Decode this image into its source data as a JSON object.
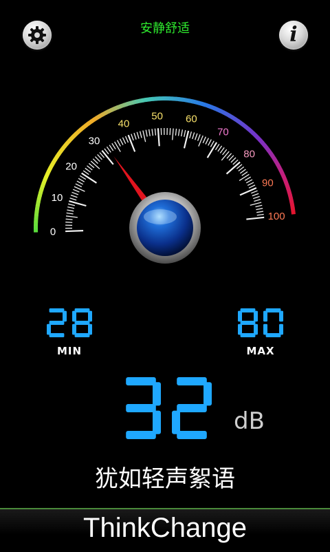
{
  "header": {
    "status_text": "安静舒适",
    "settings_icon": "gear-icon",
    "info_icon": "info-icon",
    "info_glyph": "i",
    "status_color": "#2eea2e"
  },
  "gauge": {
    "min": 0,
    "max": 100,
    "value": 32,
    "tick_labels": [
      "0",
      "10",
      "20",
      "30",
      "40",
      "50",
      "60",
      "70",
      "80",
      "90",
      "100"
    ]
  },
  "readings": {
    "min_value": "28",
    "min_label": "MIN",
    "max_value": "80",
    "max_label": "MAX",
    "current_value": "32",
    "unit": "dB",
    "digit_color": "#1fa8ff"
  },
  "description": "犹如轻声絮语",
  "footer": {
    "brand": "ThinkChange"
  }
}
